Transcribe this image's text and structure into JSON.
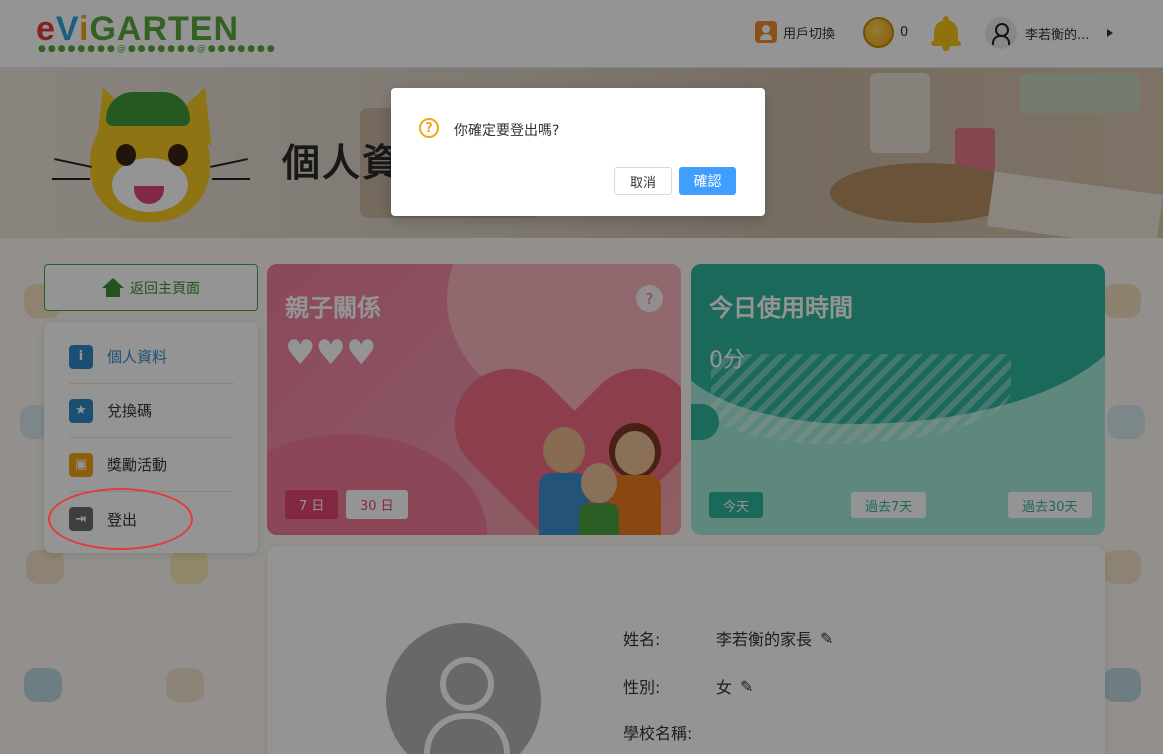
{
  "header": {
    "logo": {
      "e": "e",
      "v": "V",
      "i": "i",
      "rest": "GARTEN"
    },
    "switch_user_label": "用戶切換",
    "coin_count": "0",
    "user_name": "李若衡的..."
  },
  "banner": {
    "title": "個人資"
  },
  "sidebar": {
    "home_label": "返回主頁面",
    "items": [
      {
        "label": "個人資料",
        "icon": "info-icon",
        "color": "#2f8ac9"
      },
      {
        "label": "兌換碼",
        "icon": "star-icon",
        "color": "#2f8ac9"
      },
      {
        "label": "獎勵活動",
        "icon": "gift-icon",
        "color": "#f2a416"
      },
      {
        "label": "登出",
        "icon": "logout-icon",
        "color": "#6b6b6b"
      }
    ]
  },
  "parent_card": {
    "title": "親子關係",
    "hearts": "♥♥♥",
    "help": "?",
    "range_7": "7 日",
    "range_30": "30 日"
  },
  "time_card": {
    "title": "今日使用時間",
    "value": "0分",
    "today": "今天",
    "past_7": "過去7天",
    "past_30": "過去30天"
  },
  "profile": {
    "name_label": "姓名:",
    "name_value": "李若衡的家長",
    "gender_label": "性別:",
    "gender_value": "女",
    "school_label": "學校名稱:",
    "edit_icon": "✎"
  },
  "dialog": {
    "icon": "?",
    "message": "你確定要登出嗎?",
    "cancel": "取消",
    "confirm": "確認"
  },
  "colors": {
    "accent_blue": "#409eff",
    "brand_green": "#4aa23f",
    "alert_red": "#e33b3b",
    "overlay": "rgba(0,0,0,0.42)"
  }
}
